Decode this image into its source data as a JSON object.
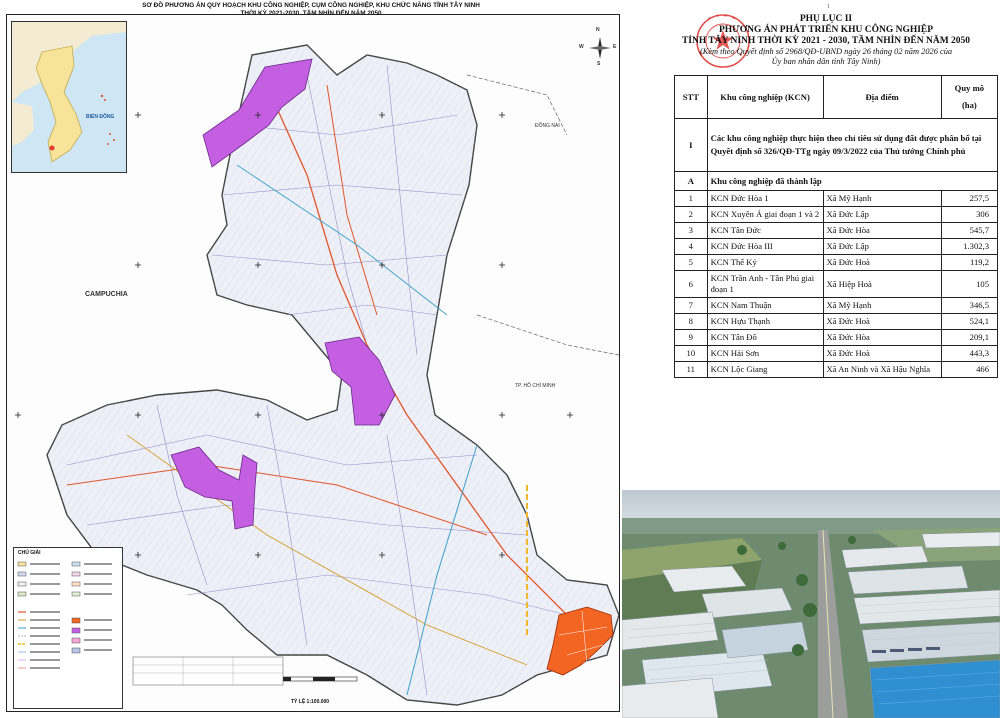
{
  "map": {
    "title_line1": "SƠ ĐỒ PHƯƠNG ÁN QUY HOẠCH KHU CÔNG NGHIỆP, CỤM CÔNG NGHIỆP, KHU CHỨC NĂNG TỈNH TÂY NINH",
    "title_line2": "THỜI KỲ 2021-2030, TẦM NHÌN ĐẾN NĂM 2050",
    "label_campuchia": "CAMPUCHIA",
    "label_dong_nai": "ĐỒNG NAI",
    "label_hcm": "TP. HỒ CHÍ MINH",
    "label_bien_dong": "BIỂN ĐÔNG",
    "legend_title": "CHÚ GIẢI",
    "scale": "TỶ LỆ 1:100.000",
    "compass_n": "N",
    "compass_s": "S",
    "compass_e": "E",
    "compass_w": "W"
  },
  "document": {
    "page_number": "1",
    "appendix_title": "PHỤ LỤC II",
    "plan_title": "PHƯƠNG ÁN PHÁT TRIỂN KHU CÔNG NGHIỆP",
    "plan_subtitle": "TỈNH TÂY NINH THỜI KỲ 2021 - 2030, TẦM NHÌN ĐẾN NĂM 2050",
    "decision_note": "(Kèm theo Quyết định số 2968/QĐ-UBND ngày 26 tháng 02 năm 2026 của",
    "issuer_note": "Ủy ban nhân dân tỉnh Tây Ninh)",
    "table": {
      "headers": {
        "stt": "STT",
        "name": "Khu công nghiệp (KCN)",
        "location": "Địa điểm",
        "area_line1": "Quy mô",
        "area_line2": "(ha)"
      },
      "section_I": {
        "stt": "I",
        "text": "Các khu công nghiệp thực hiện theo chỉ tiêu sử dụng đất được phân bổ tại Quyết định số 326/QĐ-TTg ngày 09/3/2022 của Thủ tướng Chính phủ"
      },
      "section_A": {
        "stt": "A",
        "text": "Khu công nghiệp đã thành lập"
      },
      "rows": [
        {
          "stt": "1",
          "name": "KCN Đức Hòa 1",
          "location": "Xã Mỹ Hạnh",
          "area": "257,5"
        },
        {
          "stt": "2",
          "name": "KCN Xuyên Á giai đoạn 1 và 2",
          "location": "Xã Đức Lập",
          "area": "306"
        },
        {
          "stt": "3",
          "name": "KCN Tân Đức",
          "location": "Xã Đức Hòa",
          "area": "545,7"
        },
        {
          "stt": "4",
          "name": "KCN Đức Hòa III",
          "location": "Xã Đức Lập",
          "area": "1.302,3"
        },
        {
          "stt": "5",
          "name": "KCN Thế Kỷ",
          "location": "Xã Đức Hoà",
          "area": "119,2"
        },
        {
          "stt": "6",
          "name": "KCN Trần Anh - Tân Phú giai đoạn 1",
          "location": "Xã Hiệp Hoà",
          "area": "105"
        },
        {
          "stt": "7",
          "name": "KCN Nam Thuận",
          "location": "Xã Mỹ Hạnh",
          "area": "346,5"
        },
        {
          "stt": "8",
          "name": "KCN Hựu Thạnh",
          "location": "Xã Đức Hoà",
          "area": "524,1"
        },
        {
          "stt": "9",
          "name": "KCN Tân Đô",
          "location": "Xã Đức Hòa",
          "area": "209,1"
        },
        {
          "stt": "10",
          "name": "KCN Hải Sơn",
          "location": "Xã Đức Hoà",
          "area": "443,3"
        },
        {
          "stt": "11",
          "name": "KCN Lộc Giang",
          "location": "Xã An Ninh và Xã Hậu Nghĩa",
          "area": "466"
        }
      ]
    },
    "stamp_text": "ỦY BAN NHÂN DÂN TỈNH TÂY NINH"
  },
  "colors": {
    "industrial_zone": "#c35fe0",
    "planned_zone": "#f26522",
    "stamp_red": "#d9302a",
    "province_fill": "#eef0f8"
  }
}
